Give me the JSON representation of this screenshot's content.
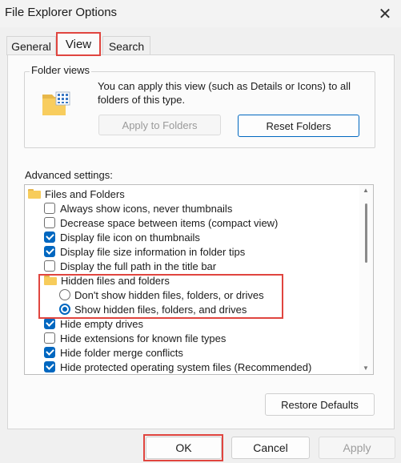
{
  "window": {
    "title": "File Explorer Options",
    "close_glyph": "✕"
  },
  "tabs": [
    {
      "label": "General",
      "selected": false
    },
    {
      "label": "View",
      "selected": true
    },
    {
      "label": "Search",
      "selected": false
    }
  ],
  "folder_views": {
    "group_label": "Folder views",
    "icon": "folder-grid-icon",
    "description": "You can apply this view (such as Details or Icons) to all folders of this type.",
    "apply_button": "Apply to Folders",
    "apply_disabled": true,
    "reset_button": "Reset Folders"
  },
  "advanced": {
    "label": "Advanced settings:",
    "items": [
      {
        "kind": "folder",
        "label": "Files and Folders"
      },
      {
        "kind": "checkbox",
        "checked": false,
        "label": "Always show icons, never thumbnails"
      },
      {
        "kind": "checkbox",
        "checked": false,
        "label": "Decrease space between items (compact view)"
      },
      {
        "kind": "checkbox",
        "checked": true,
        "label": "Display file icon on thumbnails"
      },
      {
        "kind": "checkbox",
        "checked": true,
        "label": "Display file size information in folder tips"
      },
      {
        "kind": "checkbox",
        "checked": false,
        "label": "Display the full path in the title bar"
      },
      {
        "kind": "folder",
        "label": "Hidden files and folders"
      },
      {
        "kind": "radio",
        "selected": false,
        "label": "Don't show hidden files, folders, or drives"
      },
      {
        "kind": "radio",
        "selected": true,
        "label": "Show hidden files, folders, and drives"
      },
      {
        "kind": "checkbox",
        "checked": true,
        "label": "Hide empty drives"
      },
      {
        "kind": "checkbox",
        "checked": false,
        "label": "Hide extensions for known file types"
      },
      {
        "kind": "checkbox",
        "checked": true,
        "label": "Hide folder merge conflicts"
      },
      {
        "kind": "checkbox",
        "checked": true,
        "label": "Hide protected operating system files (Recommended)"
      }
    ],
    "restore_button": "Restore Defaults"
  },
  "footer": {
    "ok": "OK",
    "cancel": "Cancel",
    "apply": "Apply",
    "apply_disabled": true
  },
  "colors": {
    "accent": "#0067c0",
    "highlight_annotation": "#e0453f"
  }
}
